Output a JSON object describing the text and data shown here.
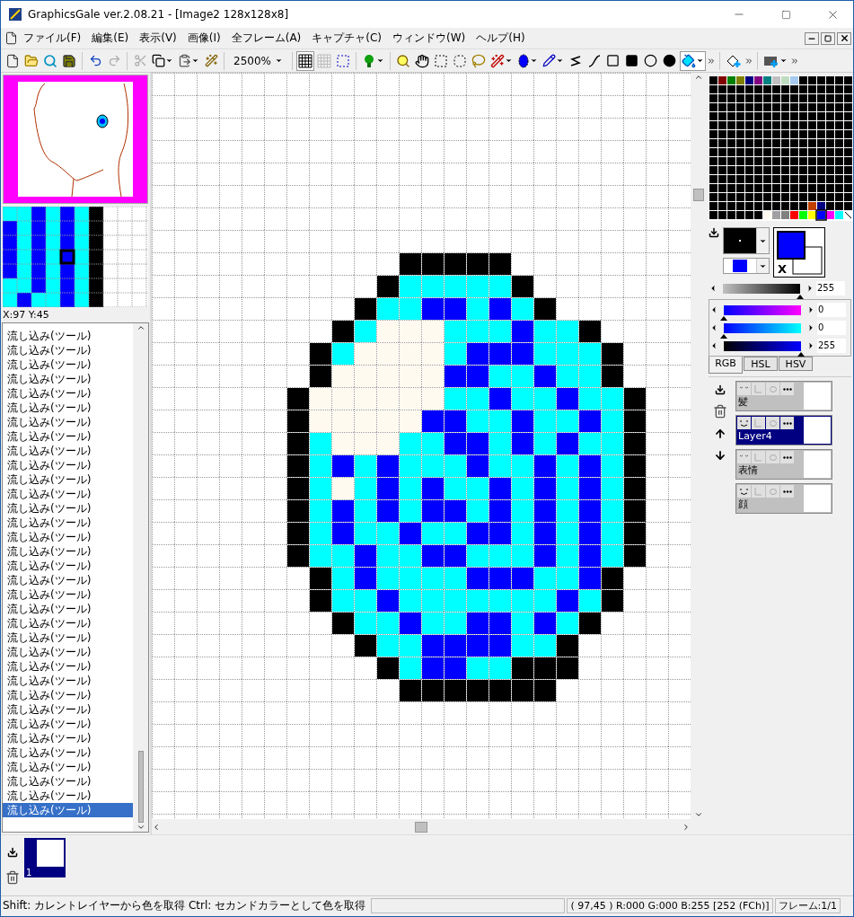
{
  "window": {
    "title": "GraphicsGale ver.2.08.21 - [Image2 128x128x8]"
  },
  "menu": [
    "ファイル(F)",
    "編集(E)",
    "表示(V)",
    "画像(I)",
    "全フレーム(A)",
    "キャプチャ(C)",
    "ウィンドウ(W)",
    "ヘルプ(H)"
  ],
  "toolbar": {
    "zoom": "2500%"
  },
  "navigator": {
    "coordinates": "X:97 Y:45"
  },
  "history": [
    {
      "label": "流し込み(ツール)",
      "selected": false
    },
    {
      "label": "流し込み(ツール)",
      "selected": false
    },
    {
      "label": "流し込み(ツール)",
      "selected": false
    },
    {
      "label": "流し込み(ツール)",
      "selected": false
    },
    {
      "label": "流し込み(ツール)",
      "selected": false
    },
    {
      "label": "流し込み(ツール)",
      "selected": false
    },
    {
      "label": "流し込み(ツール)",
      "selected": false
    },
    {
      "label": "流し込み(ツール)",
      "selected": false
    },
    {
      "label": "流し込み(ツール)",
      "selected": false
    },
    {
      "label": "流し込み(ツール)",
      "selected": false
    },
    {
      "label": "流し込み(ツール)",
      "selected": false
    },
    {
      "label": "流し込み(ツール)",
      "selected": false
    },
    {
      "label": "流し込み(ツール)",
      "selected": false
    },
    {
      "label": "流し込み(ツール)",
      "selected": false
    },
    {
      "label": "流し込み(ツール)",
      "selected": false
    },
    {
      "label": "流し込み(ツール)",
      "selected": false
    },
    {
      "label": "流し込み(ツール)",
      "selected": false
    },
    {
      "label": "流し込み(ツール)",
      "selected": false
    },
    {
      "label": "流し込み(ツール)",
      "selected": false
    },
    {
      "label": "流し込み(ツール)",
      "selected": false
    },
    {
      "label": "流し込み(ツール)",
      "selected": false
    },
    {
      "label": "流し込み(ツール)",
      "selected": false
    },
    {
      "label": "流し込み(ツール)",
      "selected": false
    },
    {
      "label": "流し込み(ツール)",
      "selected": false
    },
    {
      "label": "流し込み(ツール)",
      "selected": false
    },
    {
      "label": "流し込み(ツール)",
      "selected": false
    },
    {
      "label": "流し込み(ツール)",
      "selected": false
    },
    {
      "label": "流し込み(ツール)",
      "selected": false
    },
    {
      "label": "流し込み(ツール)",
      "selected": false
    },
    {
      "label": "流し込み(ツール)",
      "selected": false
    },
    {
      "label": "流し込み(ツール)",
      "selected": false
    },
    {
      "label": "流し込み(ツール)",
      "selected": false
    },
    {
      "label": "流し込み(ツール)",
      "selected": false
    },
    {
      "label": "流し込み(ツール)",
      "selected": true
    }
  ],
  "color_box": {
    "swap_label": "X"
  },
  "gray_slider": {
    "level": 1,
    "value": "255"
  },
  "color_model": {
    "tabs": [
      {
        "label": "RGB",
        "selected": true
      },
      {
        "label": "HSL",
        "selected": false
      },
      {
        "label": "HSV",
        "selected": false
      }
    ],
    "sliders": [
      {
        "kind": "red",
        "level": 0,
        "value": "0"
      },
      {
        "kind": "green",
        "level": 0,
        "value": "0"
      },
      {
        "kind": "blue",
        "level": 1,
        "value": "255"
      }
    ]
  },
  "layers": [
    {
      "name": "髪",
      "visible": false,
      "selected": false
    },
    {
      "name": "Layer4",
      "visible": true,
      "selected": true
    },
    {
      "name": "表情",
      "visible": false,
      "selected": false
    },
    {
      "name": "顔",
      "visible": true,
      "selected": false
    }
  ],
  "frames": [
    {
      "label": "1",
      "selected": true
    }
  ],
  "status_bar": {
    "hint": "Shift: カレントレイヤーから色を取得  Ctrl: セカンドカラーとして色を取得",
    "pixel_info": "( 97,45 ) R:000 G:000 B:255  [252 (FCh)]",
    "frame": "フレーム:1/1"
  }
}
